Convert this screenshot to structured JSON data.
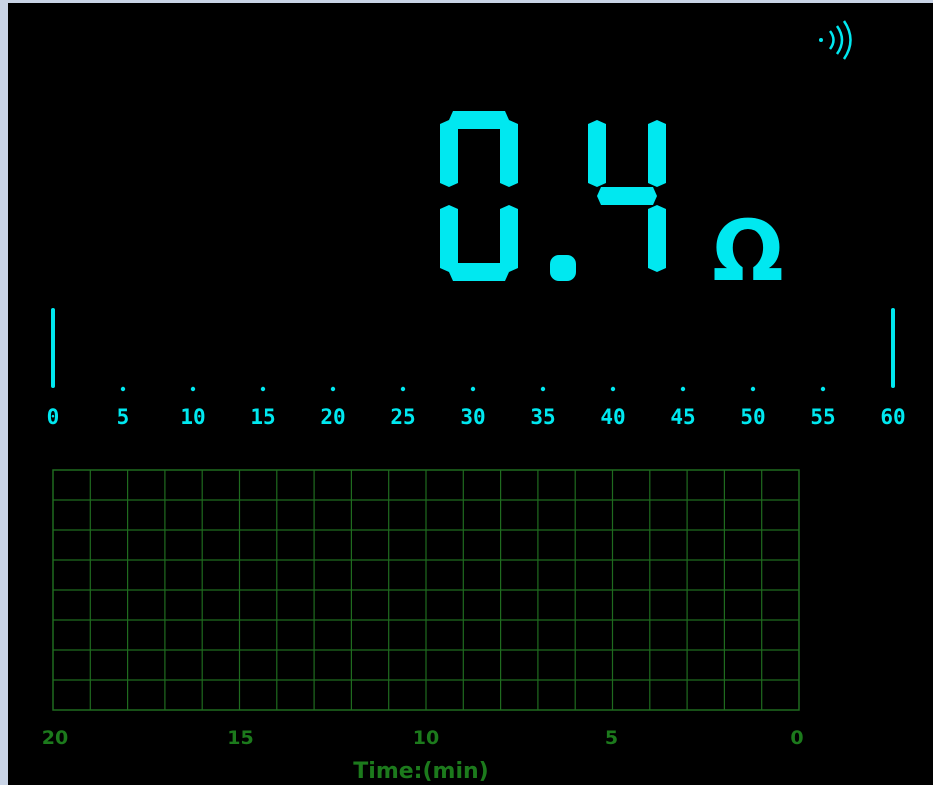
{
  "reading": {
    "value": "0.4",
    "unit": "Ω",
    "continuity_icon": "continuity-beeper-icon"
  },
  "bar_scale": {
    "labels": [
      "0",
      "5",
      "10",
      "15",
      "20",
      "25",
      "30",
      "35",
      "40",
      "45",
      "50",
      "55",
      "60"
    ],
    "min": 0,
    "max": 60,
    "level": 0.4
  },
  "trend": {
    "x_labels": [
      "20",
      "15",
      "10",
      "5",
      "0"
    ],
    "x_title": "Time:(min)",
    "grid_columns": 20,
    "grid_rows": 8
  },
  "colors": {
    "background": "#000000",
    "display": "#00e8f0",
    "grid": "#1f6b1f",
    "axis_text": "#1c7a1c",
    "frame": "#c9d4e6"
  }
}
